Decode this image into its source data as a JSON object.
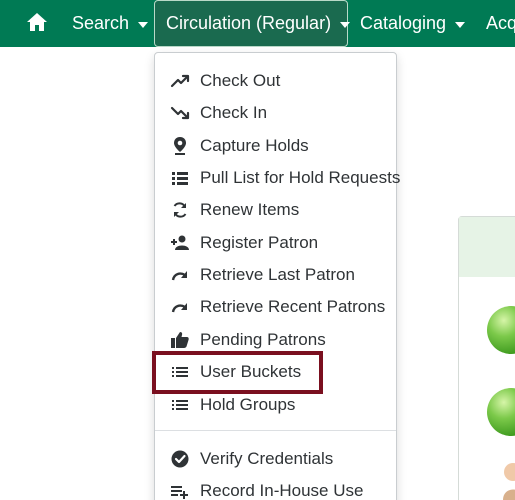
{
  "navbar": {
    "items": [
      {
        "label": "Search"
      },
      {
        "label": "Circulation (Regular)"
      },
      {
        "label": "Cataloging"
      },
      {
        "label": "Acq"
      }
    ]
  },
  "menu": {
    "items": [
      {
        "label": "Check Out",
        "icon": "trend-up-icon"
      },
      {
        "label": "Check In",
        "icon": "trend-down-icon"
      },
      {
        "label": "Capture Holds",
        "icon": "map-pin-icon"
      },
      {
        "label": "Pull List for Hold Requests",
        "icon": "list-icon"
      },
      {
        "label": "Renew Items",
        "icon": "refresh-icon"
      },
      {
        "label": "Register Patron",
        "icon": "person-add-icon"
      },
      {
        "label": "Retrieve Last Patron",
        "icon": "redo-arrow-icon"
      },
      {
        "label": "Retrieve Recent Patrons",
        "icon": "redo-arrow-icon"
      },
      {
        "label": "Pending Patrons",
        "icon": "thumbs-up-icon"
      },
      {
        "label": "User Buckets",
        "icon": "list-icon"
      },
      {
        "label": "Hold Groups",
        "icon": "list-icon"
      },
      {
        "label": "Verify Credentials",
        "icon": "check-circle-icon"
      },
      {
        "label": "Record In-House Use",
        "icon": "playlist-add-icon"
      }
    ]
  },
  "colors": {
    "navbar": "#007a54",
    "highlight": "#7a0f1f"
  }
}
